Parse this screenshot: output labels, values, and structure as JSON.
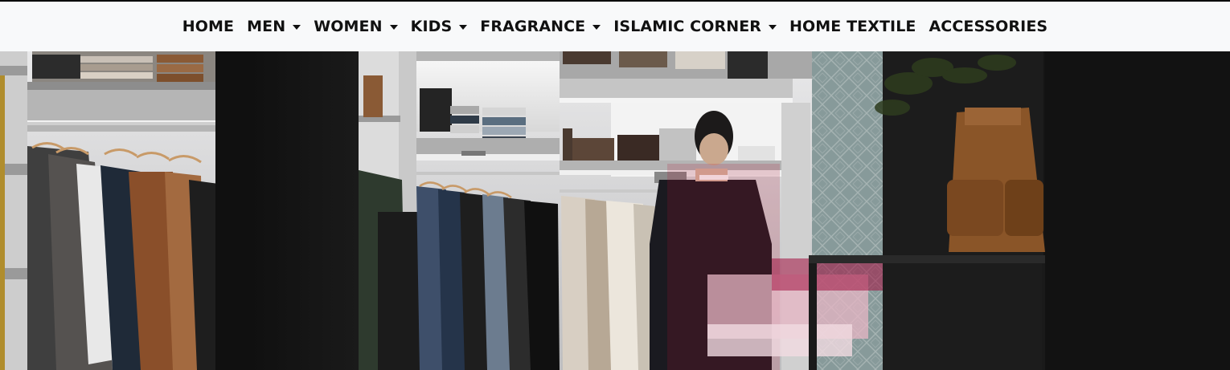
{
  "nav": {
    "items": [
      {
        "label": "HOME",
        "dropdown": false
      },
      {
        "label": "MEN",
        "dropdown": true
      },
      {
        "label": "WOMEN",
        "dropdown": true
      },
      {
        "label": "KIDS",
        "dropdown": true
      },
      {
        "label": "FRAGRANCE",
        "dropdown": true
      },
      {
        "label": "ISLAMIC CORNER",
        "dropdown": true
      },
      {
        "label": "HOME TEXTILE",
        "dropdown": false
      },
      {
        "label": "ACCESSORIES",
        "dropdown": false
      }
    ]
  },
  "hero": {
    "image": "clothing-store-interior-photo"
  },
  "colors": {
    "navbar_bg": "#f8f9fa",
    "nav_text": "#111111",
    "hero_dark": "#151515"
  }
}
